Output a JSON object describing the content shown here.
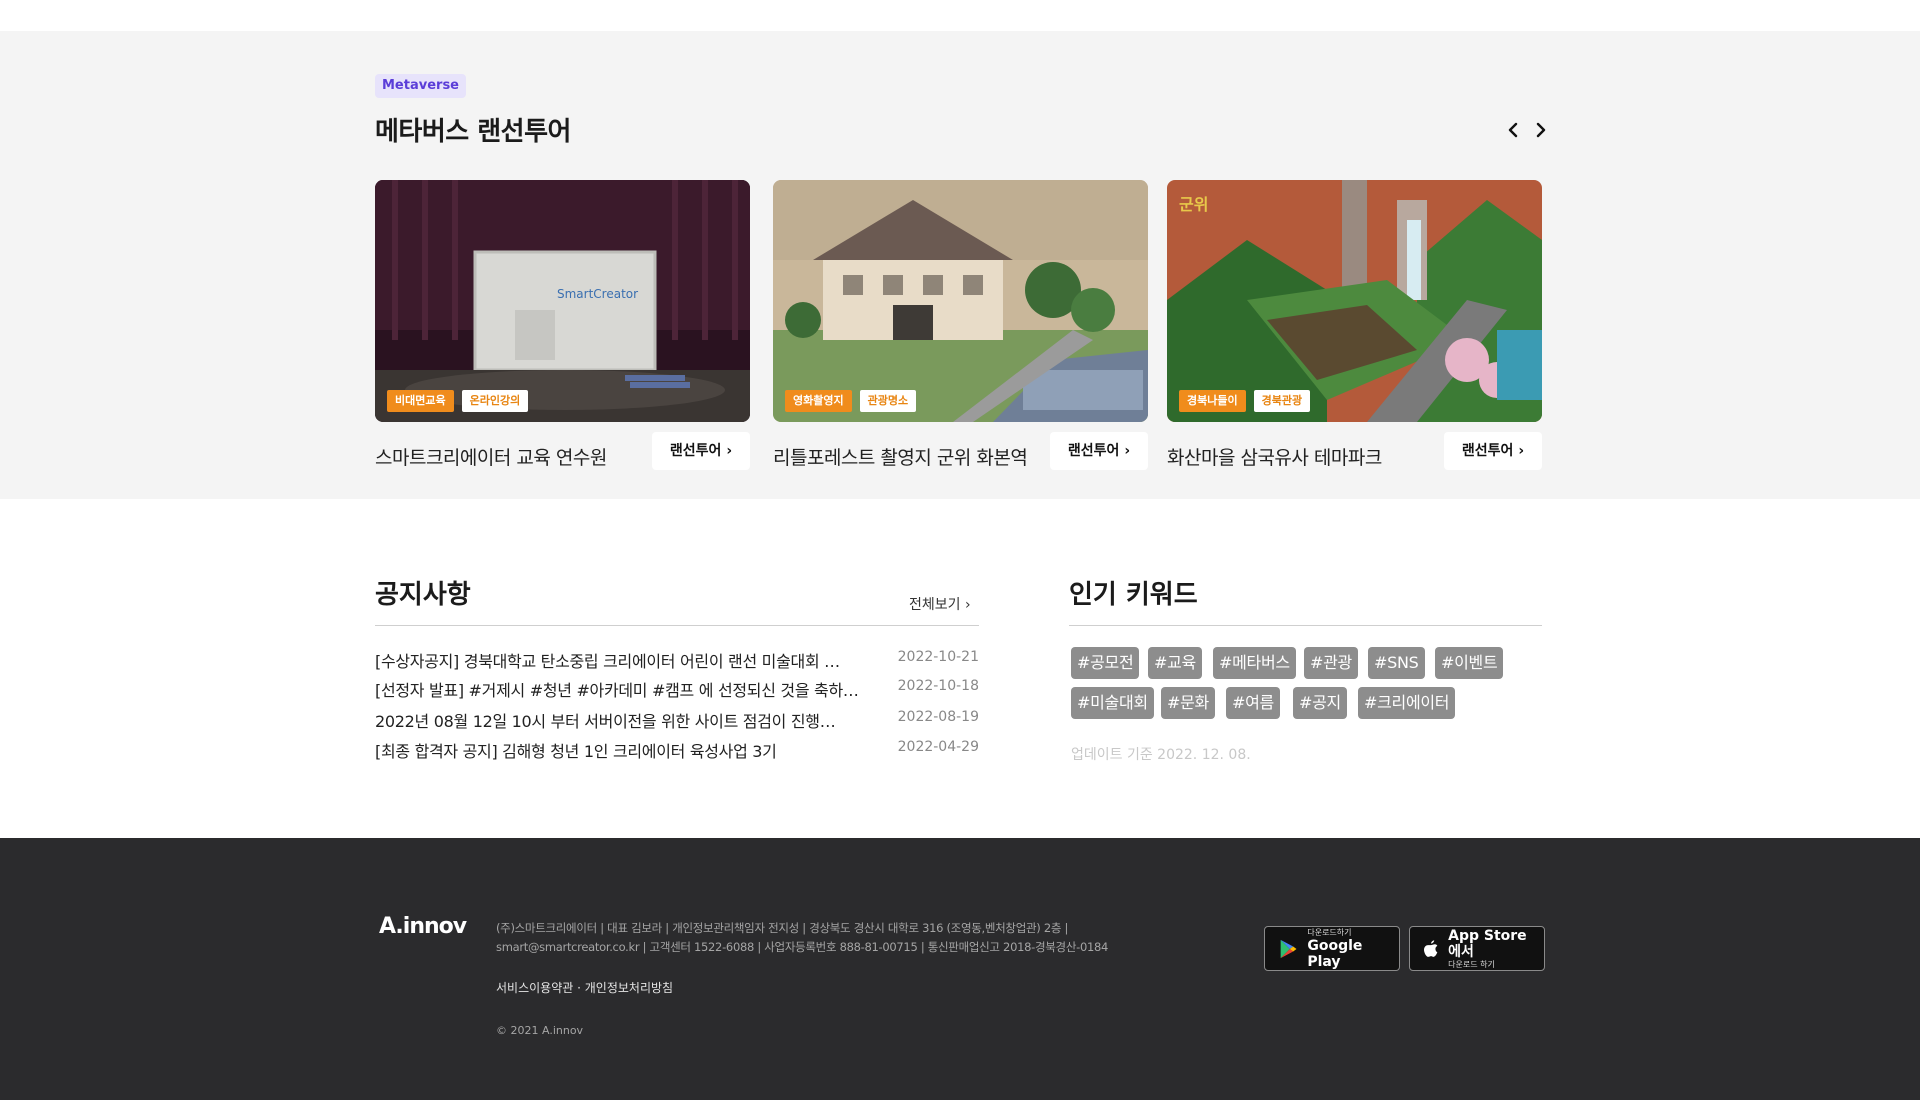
{
  "meta": {
    "badge": "Metaverse",
    "title": "메타버스 랜선투어",
    "prev_icon": "chevron-left-icon",
    "next_icon": "chevron-right-icon",
    "cards": [
      {
        "tags": [
          "비대면교육",
          "온라인강의"
        ],
        "title": "스마트크리에이터 교육 연수원",
        "button": "랜선투어"
      },
      {
        "tags": [
          "영화촬영지",
          "관광명소"
        ],
        "title": "리틀포레스트 촬영지 군위 화본역",
        "button": "랜선투어"
      },
      {
        "tags": [
          "경북나들이",
          "경북관광"
        ],
        "title": "화산마을 삼국유사 테마파크",
        "button": "랜선투어"
      }
    ],
    "card1_screen_text": "SmartCreator",
    "card3_logo_text": "군위"
  },
  "notice": {
    "title": "공지사항",
    "see_all": "전체보기",
    "items": [
      {
        "text": "[수상자공지] 경북대학교 탄소중립 크리에이터 어린이 랜선 미술대회 …",
        "date": "2022-10-21"
      },
      {
        "text": "[선정자 발표] #거제시 #청년 #아카데미 #캠프 에 선정되신 것을 축하…",
        "date": "2022-10-18"
      },
      {
        "text": "2022년 08월 12일 10시 부터 서버이전을 위한 사이트 점검이 진행…",
        "date": "2022-08-19"
      },
      {
        "text": "[최종 합격자 공지] 김해형 청년 1인 크리에이터 육성사업 3기",
        "date": "2022-04-29"
      }
    ]
  },
  "keywords": {
    "title": "인기 키워드",
    "chips": [
      "#공모전",
      "#교육",
      "#메타버스",
      "#관광",
      "#SNS",
      "#이벤트",
      "#미술대회",
      "#문화",
      "#여름",
      "#공지",
      "#크리에이터"
    ],
    "update": "업데이트 기준 2022. 12. 08."
  },
  "footer": {
    "logo": "A.innov",
    "info_line1": "(주)스마트크리에이터 | 대표 김보라 | 개인정보관리책임자 전지성 | 경상북도 경산시 대학로 316 (조영동,벤처창업관) 2층 |",
    "info_line2": "smart@smartcreator.co.kr | 고객센터 1522-6088 | 사업자등록번호 888-81-00715 | 통신판매업신고 2018-경북경산-0184",
    "terms": "서비스이용약관",
    "separator": "·",
    "privacy": "개인정보처리방침",
    "copyright": "© 2021 A.innov",
    "google_small": "다운로드하기",
    "google_big": "Google Play",
    "apple_big": "App Store에서",
    "apple_small": "다운로드 하기"
  },
  "colors": {
    "accent_orange": "#f08c1c",
    "badge_purple": "#5b3ed8",
    "footer_bg": "#2b2b2d"
  }
}
